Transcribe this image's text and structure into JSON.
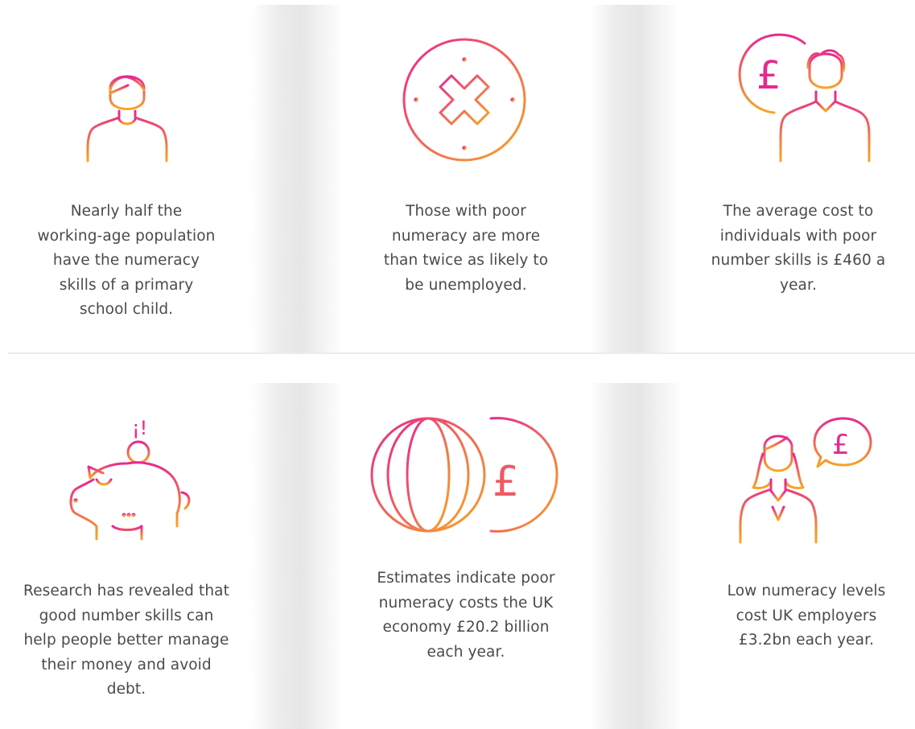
{
  "colors": {
    "gradient_start": "#e8288f",
    "gradient_end": "#f7a623",
    "text": "#4a4a4a",
    "gap_shade": "#e6e6e6"
  },
  "cards": [
    {
      "icon": "person-icon",
      "text": "Nearly half the working-age population have the numeracy skills of a primary school child."
    },
    {
      "icon": "cross-circle-icon",
      "text": "Those with poor numeracy are more than twice as likely to be unemployed."
    },
    {
      "icon": "pound-coin-person-icon",
      "text": "The average cost to individuals with poor number skills is £460 a year."
    },
    {
      "icon": "piggy-bank-icon",
      "text": "Research has revealed that good number skills can help people better manage their money and avoid debt."
    },
    {
      "icon": "globe-pound-icon",
      "text": "Estimates indicate poor numeracy costs the UK economy £20.2 billion each year."
    },
    {
      "icon": "woman-speech-pound-icon",
      "text": "Low numeracy levels cost UK employers £3.2bn each year."
    }
  ],
  "icon_glyphs": {
    "pound": "£",
    "exclaim": "¡!"
  }
}
